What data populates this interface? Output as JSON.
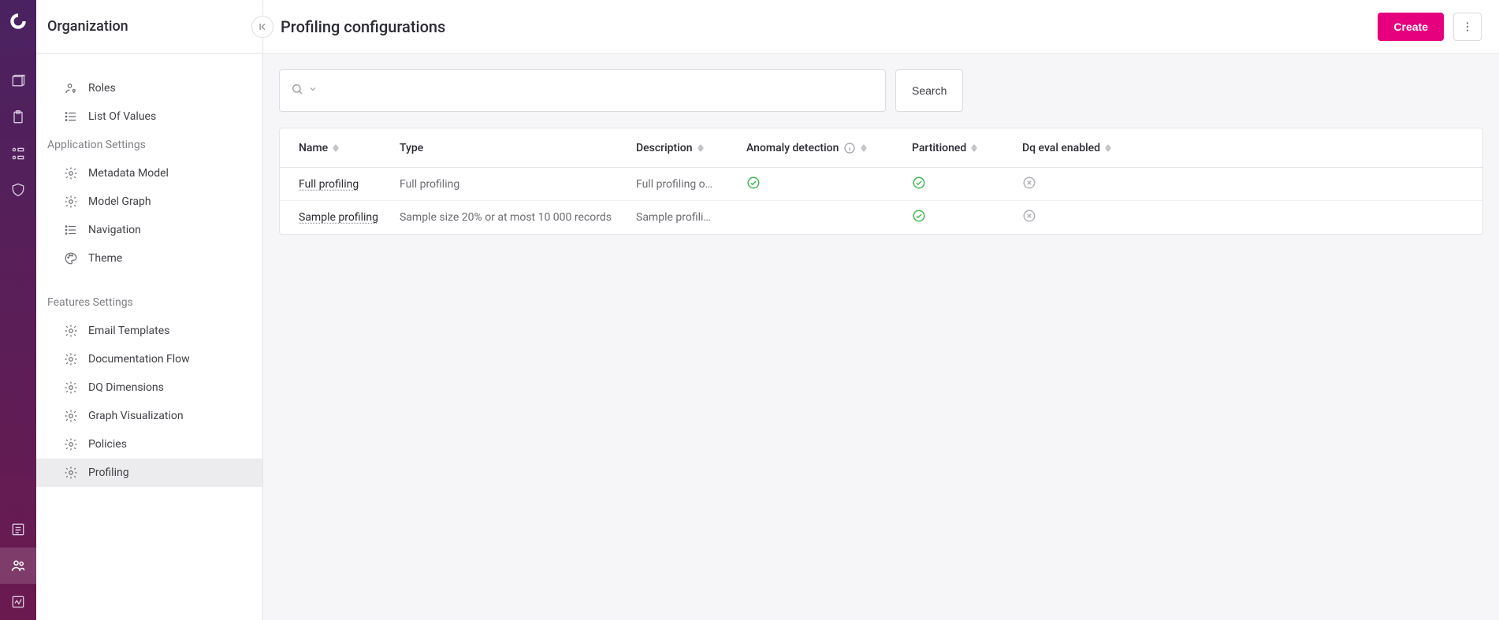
{
  "sidebar": {
    "title": "Organization",
    "items_top": [
      {
        "label": "Roles",
        "icon": "roles"
      },
      {
        "label": "List Of Values",
        "icon": "list"
      }
    ],
    "sections": [
      {
        "title": "Application Settings",
        "items": [
          {
            "label": "Metadata Model",
            "icon": "gear"
          },
          {
            "label": "Model Graph",
            "icon": "gear"
          },
          {
            "label": "Navigation",
            "icon": "list"
          },
          {
            "label": "Theme",
            "icon": "palette"
          }
        ]
      },
      {
        "title": "Features Settings",
        "items": [
          {
            "label": "Email Templates",
            "icon": "gear"
          },
          {
            "label": "Documentation Flow",
            "icon": "gear"
          },
          {
            "label": "DQ Dimensions",
            "icon": "gear"
          },
          {
            "label": "Graph Visualization",
            "icon": "gear"
          },
          {
            "label": "Policies",
            "icon": "gear"
          },
          {
            "label": "Profiling",
            "icon": "gear",
            "active": true
          }
        ]
      }
    ]
  },
  "header": {
    "title": "Profiling configurations",
    "create_label": "Create"
  },
  "search": {
    "button_label": "Search",
    "placeholder": ""
  },
  "table": {
    "columns": [
      {
        "label": "Name"
      },
      {
        "label": "Type"
      },
      {
        "label": "Description"
      },
      {
        "label": "Anomaly detection",
        "info": true
      },
      {
        "label": "Partitioned"
      },
      {
        "label": "Dq eval enabled"
      }
    ],
    "rows": [
      {
        "name": "Full profiling",
        "type": "Full profiling",
        "description": "Full profiling o…",
        "anomaly": "check",
        "partitioned": "check",
        "dq": "cross"
      },
      {
        "name": "Sample profiling",
        "type": "Sample size 20% or at most 10 000 records",
        "description": "Sample profili…",
        "anomaly": "",
        "partitioned": "check",
        "dq": "cross"
      }
    ]
  }
}
